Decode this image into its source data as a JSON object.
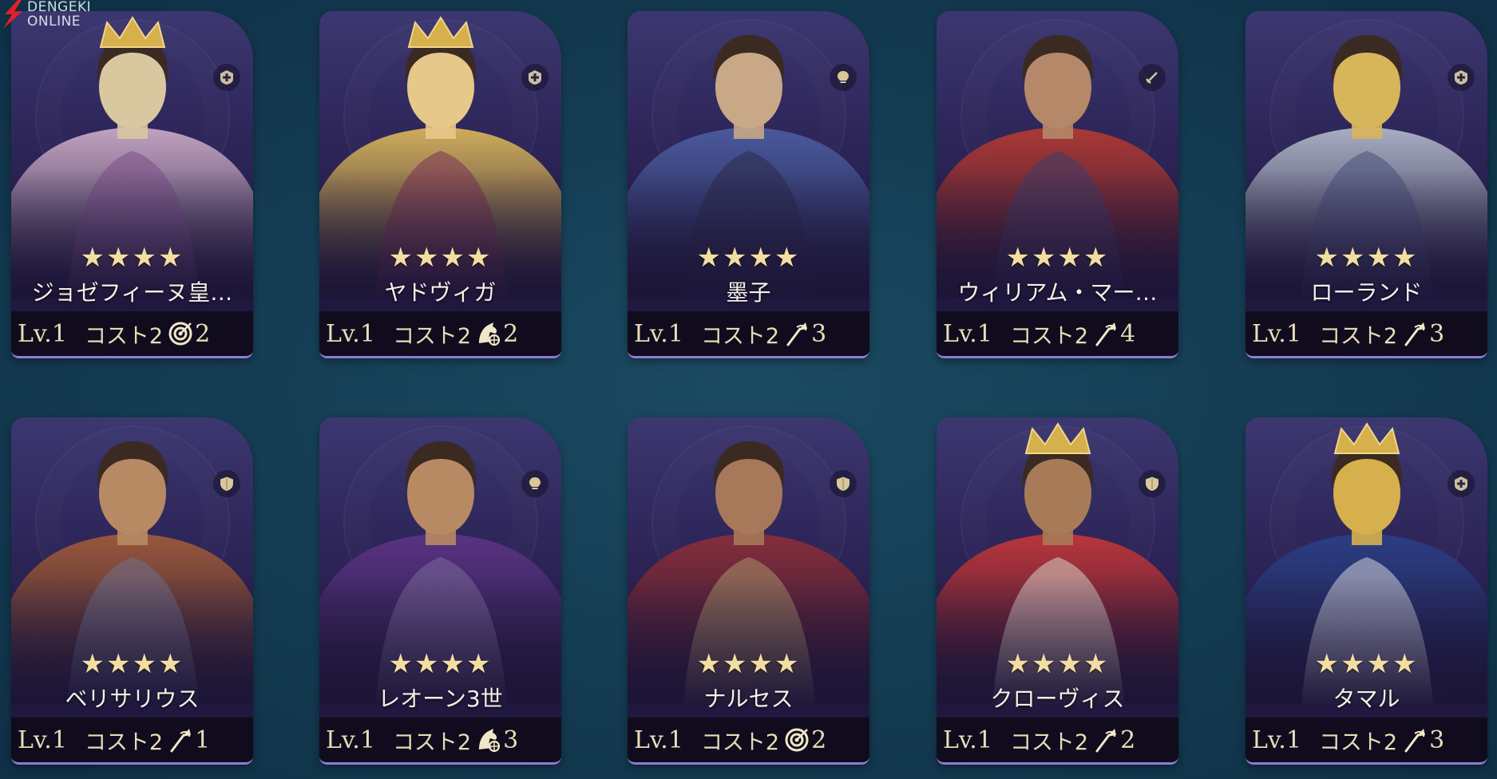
{
  "watermark": {
    "line1": "DENGEKI",
    "line2": "ONLINE"
  },
  "cards": [
    {
      "name": "ジョゼフィーヌ皇…",
      "stars": "★★★★",
      "level": "Lv.1",
      "cost": "コスト2",
      "troop_icon": "target-icon",
      "troop_value": "2",
      "class_icon": "medic-plus-icon",
      "palette": [
        "#c9a9c6",
        "#7a4f86",
        "#d9c7a0"
      ]
    },
    {
      "name": "ヤドヴィガ",
      "stars": "★★★★",
      "level": "Lv.1",
      "cost": "コスト2",
      "troop_icon": "cavalry-icon",
      "troop_value": "2",
      "class_icon": "medic-plus-icon",
      "palette": [
        "#d8b35c",
        "#7a2f56",
        "#e5c88a"
      ]
    },
    {
      "name": "墨子",
      "stars": "★★★★",
      "level": "Lv.1",
      "cost": "コスト2",
      "troop_icon": "spear-icon",
      "troop_value": "3",
      "class_icon": "bulb-icon",
      "palette": [
        "#4c5ca0",
        "#2a2a48",
        "#c8a887"
      ]
    },
    {
      "name": "ウィリアム・マー…",
      "stars": "★★★★",
      "level": "Lv.1",
      "cost": "コスト2",
      "troop_icon": "spear-icon",
      "troop_value": "4",
      "class_icon": "sword-icon",
      "palette": [
        "#b13a34",
        "#3e3d6a",
        "#b48868"
      ]
    },
    {
      "name": "ローランド",
      "stars": "★★★★",
      "level": "Lv.1",
      "cost": "コスト2",
      "troop_icon": "spear-icon",
      "troop_value": "3",
      "class_icon": "medic-plus-icon",
      "palette": [
        "#aeb5c8",
        "#48507a",
        "#d7b55a"
      ]
    },
    {
      "name": "ベリサリウス",
      "stars": "★★★★",
      "level": "Lv.1",
      "cost": "コスト2",
      "troop_icon": "spear-icon",
      "troop_value": "1",
      "class_icon": "shield-icon",
      "palette": [
        "#9f5a3a",
        "#6e6f8e",
        "#b88a64"
      ]
    },
    {
      "name": "レオーン3世",
      "stars": "★★★★",
      "level": "Lv.1",
      "cost": "コスト2",
      "troop_icon": "cavalry-icon",
      "troop_value": "3",
      "class_icon": "bulb-icon",
      "palette": [
        "#5b3485",
        "#7b6a9b",
        "#b88a64"
      ]
    },
    {
      "name": "ナルセス",
      "stars": "★★★★",
      "level": "Lv.1",
      "cost": "コスト2",
      "troop_icon": "target-icon",
      "troop_value": "2",
      "class_icon": "shield-icon",
      "palette": [
        "#8a2e3a",
        "#a8946a",
        "#a7785a"
      ]
    },
    {
      "name": "クローヴィス",
      "stars": "★★★★",
      "level": "Lv.1",
      "cost": "コスト2",
      "troop_icon": "spear-icon",
      "troop_value": "2",
      "class_icon": "shield-icon",
      "palette": [
        "#c1363a",
        "#d9d2c4",
        "#a77b58"
      ]
    },
    {
      "name": "タマル",
      "stars": "★★★★",
      "level": "Lv.1",
      "cost": "コスト2",
      "troop_icon": "spear-icon",
      "troop_value": "3",
      "class_icon": "medic-plus-icon",
      "palette": [
        "#2c3f86",
        "#d3d3dd",
        "#d6b04c"
      ]
    }
  ]
}
